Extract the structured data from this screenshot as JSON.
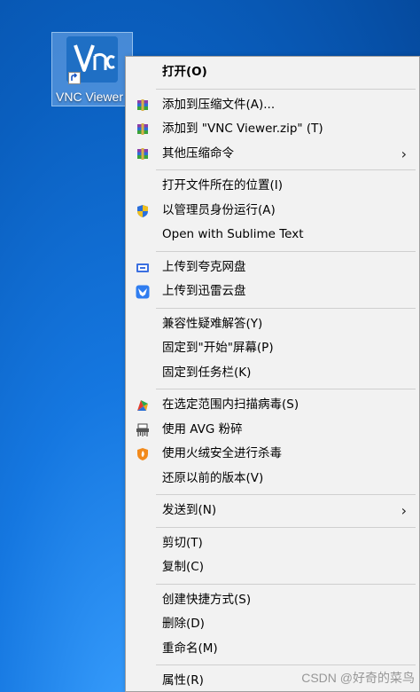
{
  "desktop": {
    "icon_label": "VNC Viewer",
    "logo_text": "VNC"
  },
  "menu": {
    "items": [
      {
        "label": "打开(O)",
        "bold": true
      },
      {
        "label": "添加到压缩文件(A)...",
        "icon": "winrar-archive-icon"
      },
      {
        "label": "添加到 \"VNC Viewer.zip\" (T)",
        "icon": "winrar-archive-icon"
      },
      {
        "label": "其他压缩命令",
        "icon": "winrar-archive-icon",
        "submenu": true
      },
      {
        "label": "打开文件所在的位置(I)"
      },
      {
        "label": "以管理员身份运行(A)",
        "icon": "uac-shield-icon"
      },
      {
        "label": "Open with Sublime Text"
      },
      {
        "label": "上传到夸克网盘",
        "icon": "quark-drive-icon"
      },
      {
        "label": "上传到迅雷云盘",
        "icon": "xunlei-cloud-icon"
      },
      {
        "label": "兼容性疑难解答(Y)"
      },
      {
        "label": "固定到\"开始\"屏幕(P)"
      },
      {
        "label": "固定到任务栏(K)"
      },
      {
        "label": "在选定范围内扫描病毒(S)",
        "icon": "avg-scan-icon"
      },
      {
        "label": "使用 AVG 粉碎",
        "icon": "shredder-icon"
      },
      {
        "label": "使用火绒安全进行杀毒",
        "icon": "huorong-shield-icon"
      },
      {
        "label": "还原以前的版本(V)"
      },
      {
        "label": "发送到(N)",
        "submenu": true
      },
      {
        "label": "剪切(T)"
      },
      {
        "label": "复制(C)"
      },
      {
        "label": "创建快捷方式(S)"
      },
      {
        "label": "删除(D)"
      },
      {
        "label": "重命名(M)"
      },
      {
        "label": "属性(R)"
      }
    ],
    "submenu_arrow": "›"
  },
  "watermark": "CSDN @好奇的菜鸟",
  "colors": {
    "desktop_blue": "#0a5fbf",
    "menu_bg": "#f2f2f2",
    "separator": "#cfcfcf"
  }
}
